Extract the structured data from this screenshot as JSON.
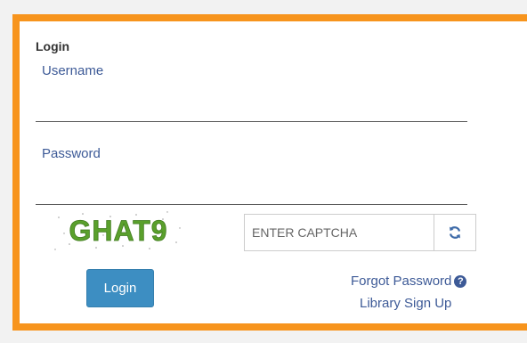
{
  "login_form": {
    "title": "Login",
    "username_label": "Username",
    "username_value": "",
    "password_label": "Password",
    "password_value": "",
    "captcha_text": "GHAT9",
    "captcha_placeholder": "ENTER CAPTCHA",
    "captcha_value": "",
    "refresh_icon": "refresh-icon",
    "login_button": "Login",
    "forgot_password": "Forgot Password",
    "help_icon": "question-circle-icon",
    "library_signup": "Library Sign Up"
  },
  "colors": {
    "frame_border": "#f7941d",
    "label_text": "#3d5a97",
    "button_bg": "#3d8ec2",
    "captcha_text": "#5aa02c"
  }
}
